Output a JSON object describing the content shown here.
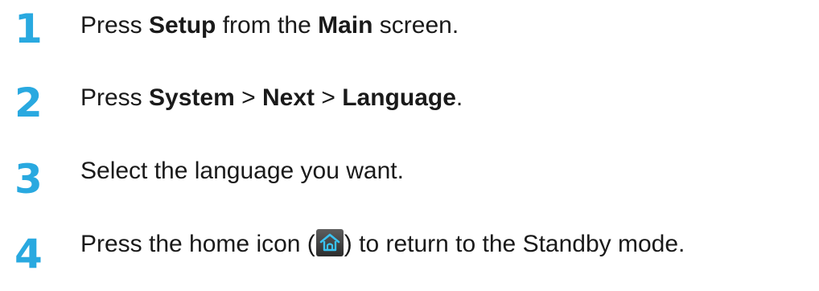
{
  "steps": [
    {
      "number": "1",
      "prefix": "Press ",
      "bold1": "Setup",
      "middle": " from the ",
      "bold2": "Main",
      "suffix": " screen."
    },
    {
      "number": "2",
      "prefix": "Press ",
      "bold1": "System",
      "sep1": " > ",
      "bold2": "Next",
      "sep2": " > ",
      "bold3": "Language",
      "suffix": "."
    },
    {
      "number": "3",
      "text": "Select the language you want."
    },
    {
      "number": "4",
      "prefix": "Press the home icon (",
      "icon": "home-icon",
      "suffix": ") to return to the Standby mode."
    }
  ],
  "colors": {
    "step_number": "#29a9e0",
    "text": "#1a1a1a",
    "icon_bg": "#3a3a3a",
    "icon_glyph": "#39c2f2"
  }
}
